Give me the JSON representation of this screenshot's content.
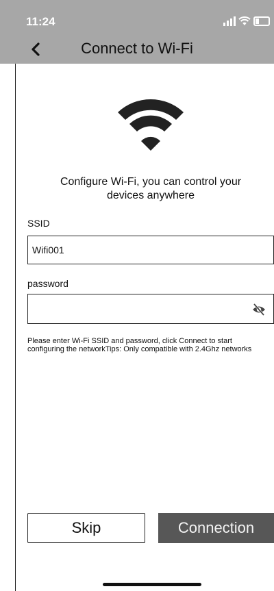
{
  "status_bar": {
    "time": "11:24",
    "icons": [
      "signal-icon",
      "wifi-icon",
      "battery-icon"
    ]
  },
  "nav": {
    "back_icon": "chevron-left-icon",
    "title": "Connect to Wi-Fi"
  },
  "hero": {
    "icon": "wifi-icon",
    "headline_line1": "Configure Wi-Fi, you can control your",
    "headline_line2": "devices anywhere"
  },
  "form": {
    "ssid_label": "SSID",
    "ssid_value": "Wifi001",
    "password_label": "password",
    "password_value": "",
    "password_toggle_icon": "eye-slash-icon"
  },
  "hint_text": "Please enter Wi-Fi SSID and password, click Connect to start configuring the networkTips: Only compatible with 2.4Ghz networks",
  "buttons": {
    "skip_label": "Skip",
    "connection_label": "Connection"
  },
  "colors": {
    "header_bg": "#a7a7a7",
    "primary_button_bg": "#575757",
    "text": "#111111"
  }
}
